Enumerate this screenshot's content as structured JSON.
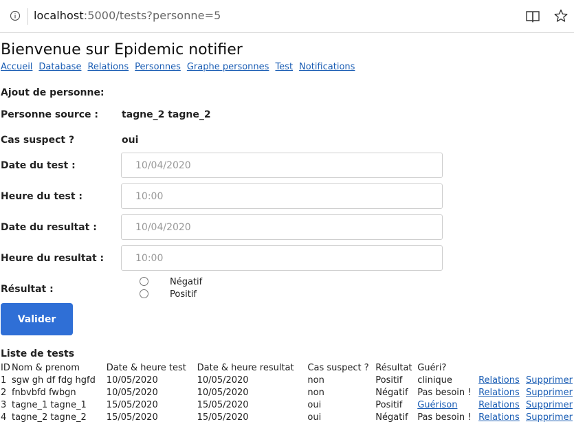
{
  "browser": {
    "url_host": "localhost",
    "url_path": ":5000/tests?personne=5",
    "info_icon": "info-icon",
    "reader_icon": "reader-view-icon",
    "favorite_icon": "star-icon"
  },
  "page": {
    "title": "Bienvenue sur Epidemic notifier",
    "nav": [
      "Accueil",
      "Database",
      "Relations",
      "Personnes",
      "Graphe personnes",
      "Test",
      "Notifications"
    ],
    "link_color": "#1a5db4"
  },
  "form": {
    "heading": "Ajout de personne:",
    "source_label": "Personne source :",
    "source_value": "tagne_2 tagne_2",
    "suspect_label": "Cas suspect ?",
    "suspect_value": "oui",
    "test_date_label": "Date du test :",
    "test_date_placeholder": "10/04/2020",
    "test_time_label": "Heure du test :",
    "test_time_placeholder": "10:00",
    "result_date_label": "Date du resultat :",
    "result_date_placeholder": "10/04/2020",
    "result_time_label": "Heure du resultat :",
    "result_time_placeholder": "10:00",
    "result_label": "Résultat :",
    "result_options": [
      "Négatif",
      "Positif"
    ],
    "submit_label": "Valider",
    "submit_color": "#2f6fd6"
  },
  "tests": {
    "title": "Liste de tests",
    "headers": [
      "ID",
      "Nom & prenom",
      "Date & heure test",
      "Date & heure resultat",
      "Cas suspect ?",
      "Résultat",
      "Guéri?"
    ],
    "rows": [
      {
        "id": "1",
        "name": "sgw gh df fdg hgfd",
        "test": "10/05/2020",
        "result_date": "10/05/2020",
        "suspect": "non",
        "result": "Positif",
        "cured": "clinique",
        "cured_link": false,
        "relations": "Relations",
        "delete": "Supprimer"
      },
      {
        "id": "2",
        "name": "fnbvbfd fwbgn",
        "test": "10/05/2020",
        "result_date": "10/05/2020",
        "suspect": "non",
        "result": "Négatif",
        "cured": "Pas besoin !",
        "cured_link": false,
        "relations": "Relations",
        "delete": "Supprimer"
      },
      {
        "id": "3",
        "name": "tagne_1 tagne_1",
        "test": "15/05/2020",
        "result_date": "15/05/2020",
        "suspect": "oui",
        "result": "Positif",
        "cured": "Guérison",
        "cured_link": true,
        "relations": "Relations",
        "delete": "Supprimer"
      },
      {
        "id": "4",
        "name": "tagne_2 tagne_2",
        "test": "15/05/2020",
        "result_date": "15/05/2020",
        "suspect": "oui",
        "result": "Négatif",
        "cured": "Pas besoin !",
        "cured_link": false,
        "relations": "Relations",
        "delete": "Supprimer"
      }
    ]
  }
}
